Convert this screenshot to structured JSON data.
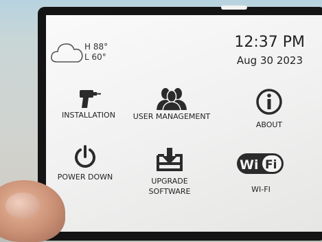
{
  "weather": {
    "high": "H 88°",
    "low": "L 60°",
    "icon": "cloud-icon"
  },
  "clock": {
    "time": "12:37 PM",
    "date": "Aug 30 2023"
  },
  "menu": {
    "installation": {
      "label": "INSTALLATION",
      "icon": "drill-icon"
    },
    "user_management": {
      "label": "USER MANAGEMENT",
      "icon": "users-icon"
    },
    "about": {
      "label": "ABOUT",
      "icon": "info-icon"
    },
    "power_down": {
      "label": "POWER DOWN",
      "icon": "power-icon"
    },
    "upgrade_software": {
      "label": "UPGRADE\nSOFTWARE",
      "icon": "download-icon"
    },
    "wifi": {
      "label": "WI-FI",
      "icon": "wifi-icon",
      "badge": "Wi Fi"
    }
  },
  "colors": {
    "screen_bg": "#f4f4f4",
    "bezel": "#141414",
    "icon": "#2b2b2b"
  }
}
